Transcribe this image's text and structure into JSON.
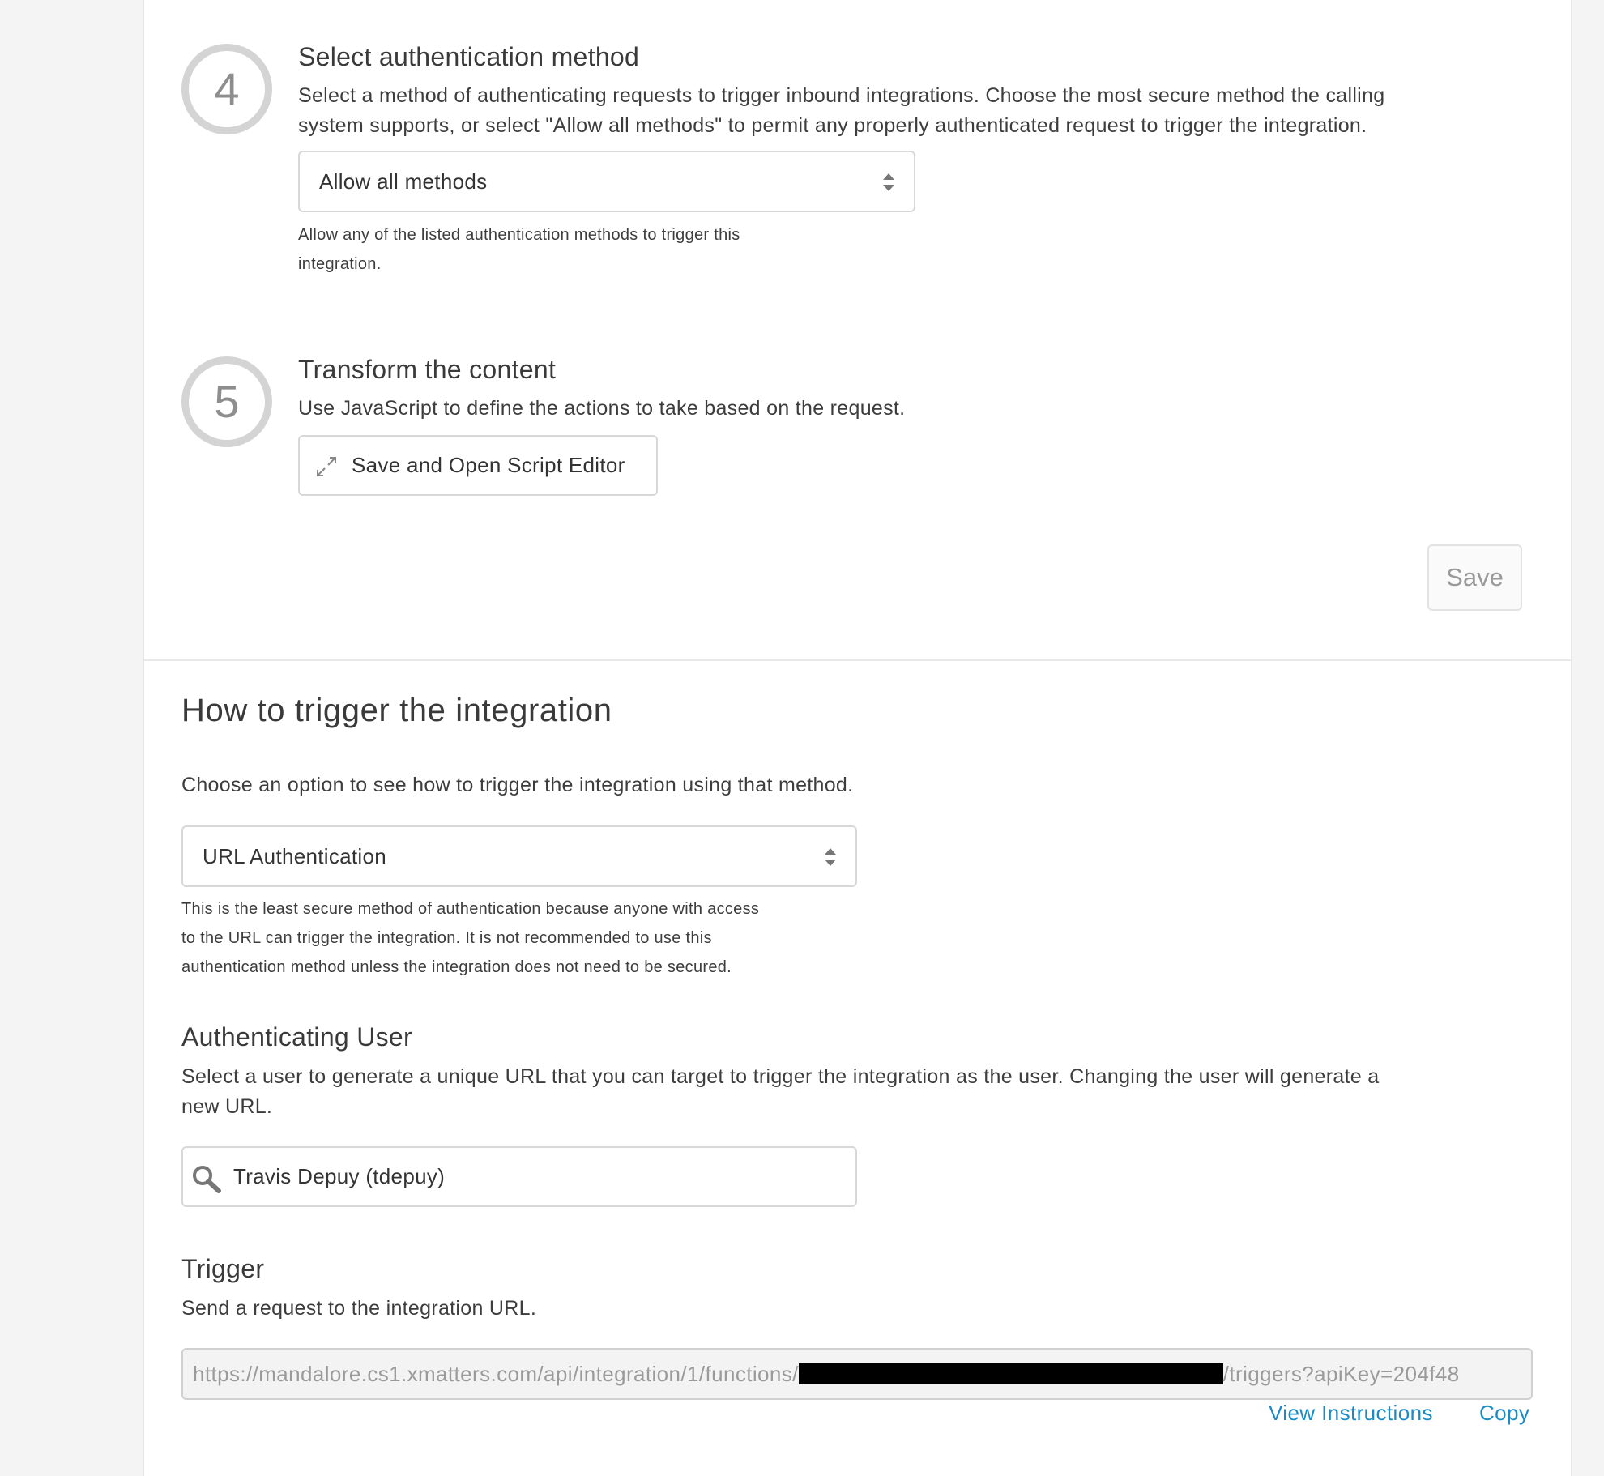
{
  "step4": {
    "number": "4",
    "title": "Select authentication method",
    "description_line1": "Select a method of authenticating requests to trigger inbound integrations. Choose the most secure method the calling",
    "description_line2": "system supports, or select \"Allow all methods\" to permit any properly authenticated request to trigger the integration.",
    "select_value": "Allow all methods",
    "help_line1": "Allow any of the listed authentication methods to trigger this",
    "help_line2": "integration."
  },
  "step5": {
    "number": "5",
    "title": "Transform the content",
    "description": "Use JavaScript to define the actions to take based on the request.",
    "script_button_label": "Save and Open Script Editor"
  },
  "save_button_label": "Save",
  "trigger_section": {
    "title": "How to trigger the integration",
    "intro": "Choose an option to see how to trigger the integration using that method.",
    "select_value": "URL Authentication",
    "help_line1": "This is the least secure method of authentication because anyone with access",
    "help_line2": "to the URL can trigger the integration. It is not recommended to use this",
    "help_line3": "authentication method unless the integration does not need to be secured.",
    "auth_user": {
      "title": "Authenticating User",
      "description_line1": "Select a user to generate a unique URL that you can target to trigger the integration as the user. Changing the user will generate a",
      "description_line2": "new URL.",
      "search_value": "Travis Depuy (tdepuy)"
    },
    "trigger": {
      "title": "Trigger",
      "description": "Send a request to the integration URL.",
      "url_prefix": "https://mandalore.cs1.xmatters.com/api/integration/1/functions/",
      "url_suffix": "/triggers?apiKey=204f48",
      "view_instructions_label": "View Instructions",
      "copy_label": "Copy"
    }
  },
  "icons": {
    "step4_select_arrows": "sort-arrows-icon",
    "expand": "expand-icon",
    "trigger_select_arrows": "sort-arrows-icon",
    "search": "search-icon"
  },
  "colors": {
    "link": "#1a8bc6",
    "step_circle": "#d4d4d4",
    "background": "#f4f4f4",
    "panel": "#ffffff"
  }
}
